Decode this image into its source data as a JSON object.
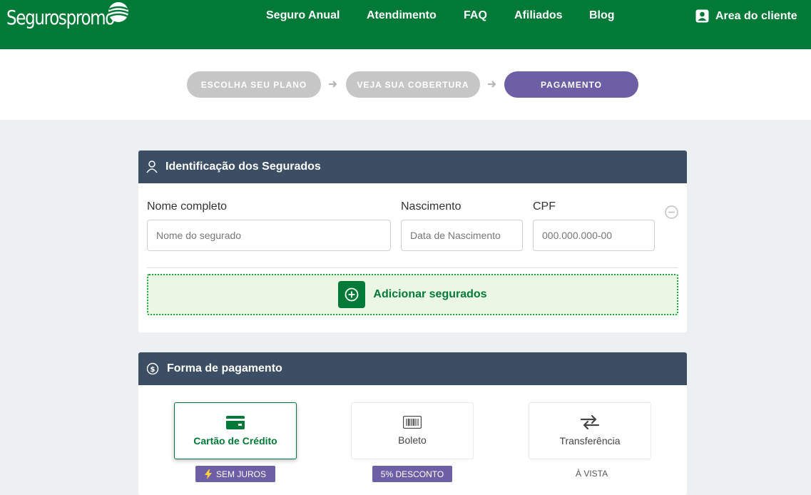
{
  "header": {
    "logo_text": "Segurospromo",
    "nav": [
      "Seguro Anual",
      "Atendimento",
      "FAQ",
      "Afiliados",
      "Blog"
    ],
    "client_label": "Area do cliente"
  },
  "steps": [
    "ESCOLHA SEU PLANO",
    "VEJA SUA COBERTURA",
    "PAGAMENTO"
  ],
  "insured": {
    "title": "Identificação dos Segurados",
    "name_label": "Nome completo",
    "name_placeholder": "Nome do segurado",
    "birth_label": "Nascimento",
    "birth_placeholder": "Data de Nascimento",
    "cpf_label": "CPF",
    "cpf_placeholder": "000.000.000-00",
    "add_label": "Adicionar segurados"
  },
  "payment": {
    "title": "Forma de pagamento",
    "options": [
      {
        "label": "Cartão de Crédito",
        "tag": "SEM JUROS"
      },
      {
        "label": "Boleto",
        "tag": "5% DESCONTO"
      },
      {
        "label": "Transferência",
        "tag": "À VISTA"
      }
    ]
  },
  "colors": {
    "brand_green": "#007a36",
    "step_active": "#6c5fa5",
    "step_inactive": "#c6c6c6",
    "card_header": "#3c4e63"
  }
}
